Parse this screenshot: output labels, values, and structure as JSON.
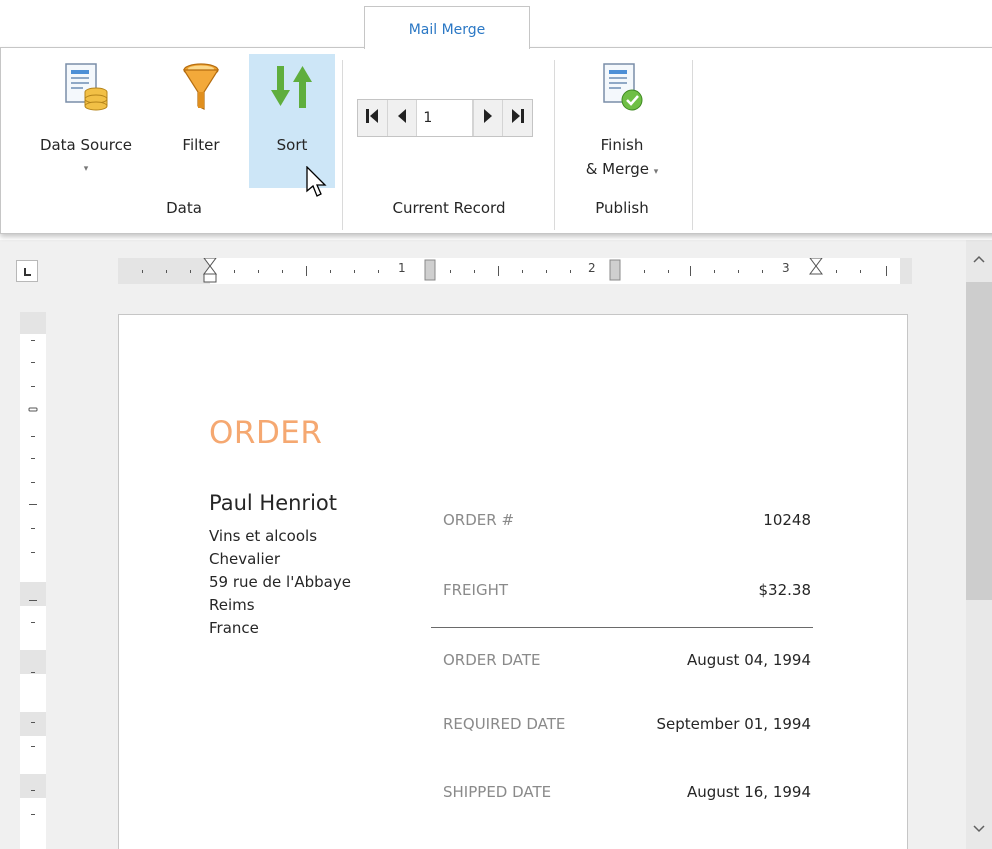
{
  "ribbon": {
    "tab_label": "Mail Merge",
    "buttons": {
      "data_source": "Data Source",
      "filter": "Filter",
      "sort": "Sort",
      "finish_line1": "Finish",
      "finish_line2": "& Merge"
    },
    "dropdown_glyph": "▾",
    "groups": {
      "data": "Data",
      "current_record": "Current Record",
      "publish": "Publish"
    },
    "record_navigator": {
      "current_record": "1"
    }
  },
  "ruler": {
    "marks": [
      "1",
      "2",
      "3"
    ]
  },
  "document": {
    "title": "ORDER",
    "customer": {
      "name": "Paul Henriot",
      "address_lines": [
        "Vins et alcools",
        "Chevalier",
        "59 rue de l'Abbaye",
        "Reims",
        "France"
      ]
    },
    "fields": [
      {
        "label": "ORDER #",
        "value": "10248"
      },
      {
        "label": "FREIGHT",
        "value": "$32.38"
      },
      {
        "label": "ORDER DATE",
        "value": "August 04, 1994"
      },
      {
        "label": "REQUIRED DATE",
        "value": "September 01, 1994"
      },
      {
        "label": "SHIPPED DATE",
        "value": "August 16, 1994"
      }
    ]
  },
  "colors": {
    "accent_tab": "#2b78c5",
    "order_title": "#f5a871",
    "active_button": "#cde6f7"
  },
  "icons": [
    "data-source-icon",
    "filter-icon",
    "sort-icon",
    "first-record-icon",
    "prev-record-icon",
    "next-record-icon",
    "last-record-icon",
    "finish-merge-icon",
    "cursor-icon"
  ]
}
